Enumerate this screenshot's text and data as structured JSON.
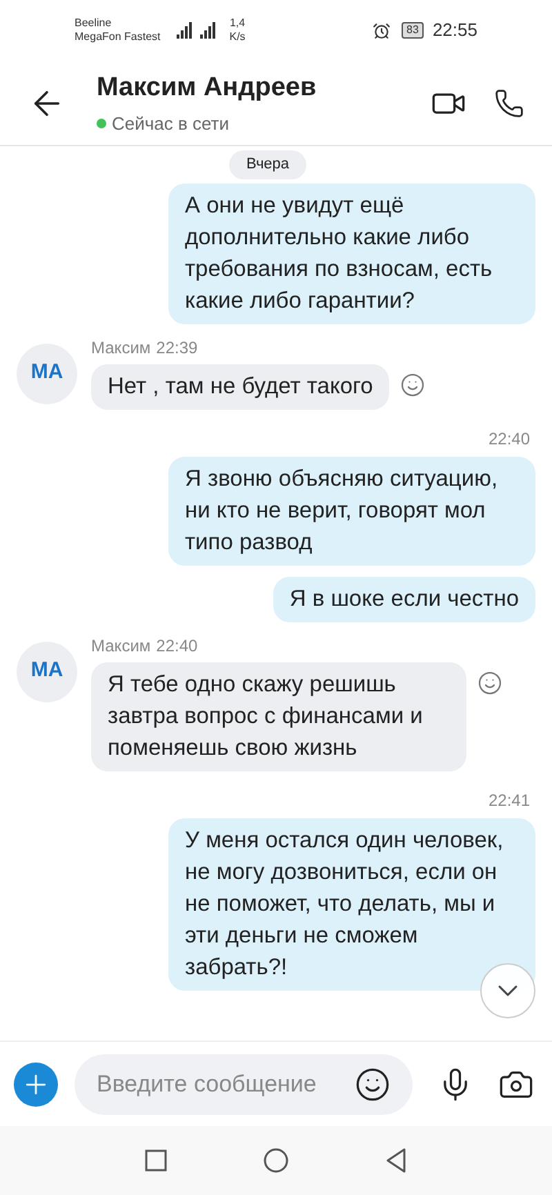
{
  "status_bar": {
    "carriers": [
      "Beeline",
      "MegaFon Fastest"
    ],
    "speed_value": "1,4",
    "speed_unit": "K/s",
    "battery": "83",
    "time": "22:55"
  },
  "header": {
    "name": "Максим Андреев",
    "presence": "Сейчас в сети",
    "online": true
  },
  "date_pill": "Вчера",
  "messages": [
    {
      "kind": "outgoing",
      "text": "А они не увидут ещё дополнительно какие либо требования по взносам, есть какие либо гарантии?"
    },
    {
      "kind": "incoming",
      "avatar": "MA",
      "sender": "Максим",
      "time": "22:39",
      "text": "Нет , там не будет такого"
    },
    {
      "kind": "time",
      "text": "22:40"
    },
    {
      "kind": "outgoing",
      "text": "Я звоню объясняю ситуацию, ни кто не верит, говорят мол типо развод"
    },
    {
      "kind": "outgoing",
      "text": "Я в шоке если честно"
    },
    {
      "kind": "incoming",
      "avatar": "MA",
      "sender": "Максим",
      "time": "22:40",
      "text": "Я тебе одно скажу решишь завтра вопрос с финансами и поменяешь свою жизнь"
    },
    {
      "kind": "time",
      "text": "22:41"
    },
    {
      "kind": "outgoing",
      "text": "У меня остался один человек, не могу дозвониться, если он не поможет, что делать, мы и эти деньги не сможем забрать?!"
    }
  ],
  "composer": {
    "placeholder": "Введите сообщение"
  }
}
